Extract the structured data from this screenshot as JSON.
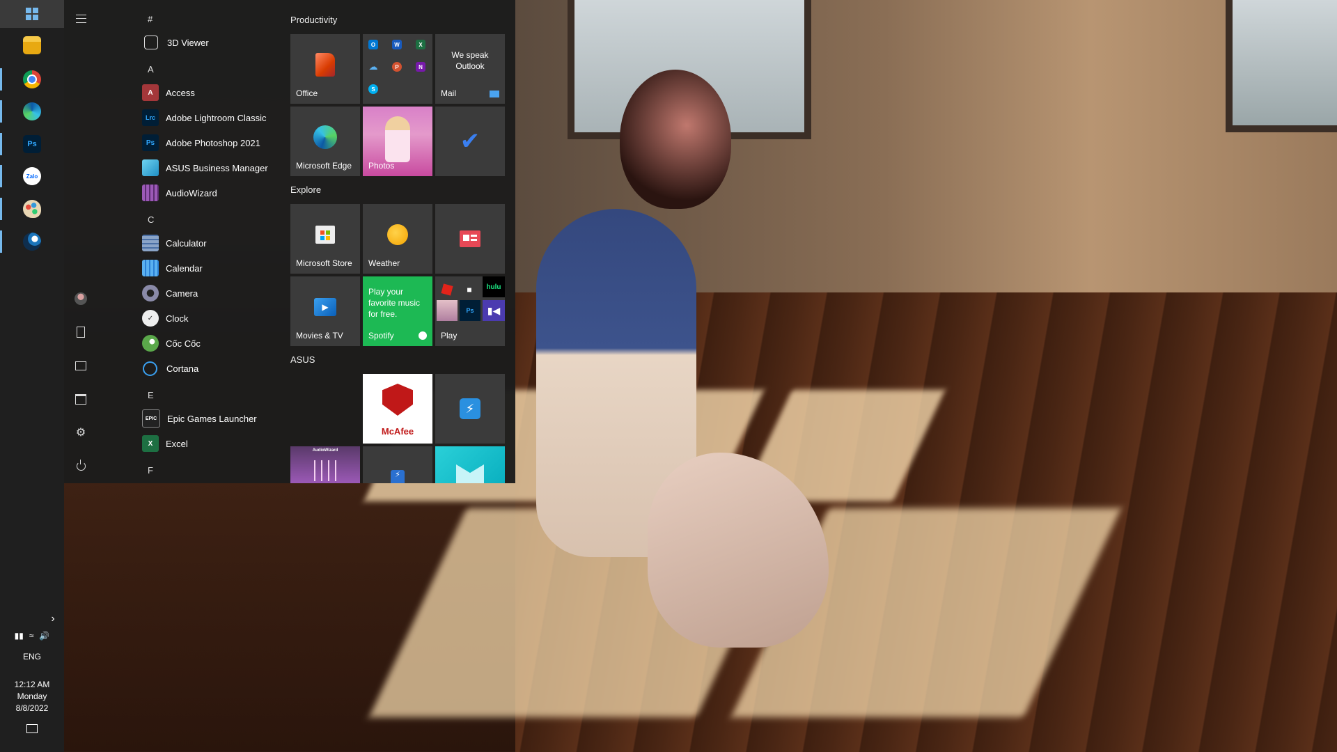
{
  "taskbar": {
    "apps": [
      {
        "name": "File Explorer",
        "icon": "folder-icon"
      },
      {
        "name": "Google Chrome",
        "icon": "chrome-icon"
      },
      {
        "name": "Microsoft Edge",
        "icon": "edge-icon"
      },
      {
        "name": "Adobe Photoshop",
        "icon": "photoshop-icon",
        "text": "Ps"
      },
      {
        "name": "Zalo",
        "icon": "zalo-icon",
        "text": "Zalo"
      },
      {
        "name": "Paint",
        "icon": "paint-icon"
      },
      {
        "name": "Steam",
        "icon": "steam-icon"
      }
    ],
    "tray": {
      "language": "ENG",
      "time": "12:12 AM",
      "day": "Monday",
      "date": "8/8/2022"
    }
  },
  "start_menu": {
    "app_list": [
      {
        "type": "letter",
        "text": "#"
      },
      {
        "type": "app",
        "label": "3D Viewer",
        "icon": "3d-viewer-icon"
      },
      {
        "type": "letter",
        "text": "A"
      },
      {
        "type": "app",
        "label": "Access",
        "icon": "access-icon",
        "glyph": "A",
        "color": "#a4373a"
      },
      {
        "type": "app",
        "label": "Adobe Lightroom Classic",
        "icon": "lightroom-icon",
        "glyph": "Lrc",
        "color": "#001e36"
      },
      {
        "type": "app",
        "label": "Adobe Photoshop 2021",
        "icon": "photoshop-icon",
        "glyph": "Ps",
        "color": "#001e36"
      },
      {
        "type": "app",
        "label": "ASUS Business Manager",
        "icon": "asus-business-manager-icon",
        "glyph": "",
        "color": "#2aa6d8"
      },
      {
        "type": "app",
        "label": "AudioWizard",
        "icon": "audiowizard-icon",
        "glyph": "",
        "color": "#7a3fa0"
      },
      {
        "type": "letter",
        "text": "C"
      },
      {
        "type": "app",
        "label": "Calculator",
        "icon": "calculator-icon",
        "glyph": "",
        "color": "#4a6fa5"
      },
      {
        "type": "app",
        "label": "Calendar",
        "icon": "calendar-icon",
        "glyph": "",
        "color": "#2a7fd4"
      },
      {
        "type": "app",
        "label": "Camera",
        "icon": "camera-icon",
        "glyph": "",
        "color": "#6a6a8a"
      },
      {
        "type": "app",
        "label": "Clock",
        "icon": "clock-icon",
        "glyph": "",
        "color": "#ddd"
      },
      {
        "type": "app",
        "label": "Cốc Cốc",
        "icon": "coccoc-icon",
        "glyph": "",
        "color": "#5aa84a"
      },
      {
        "type": "app",
        "label": "Cortana",
        "icon": "cortana-icon",
        "glyph": "",
        "color": "transparent"
      },
      {
        "type": "letter",
        "text": "E"
      },
      {
        "type": "app",
        "label": "Epic Games Launcher",
        "icon": "epic-games-icon",
        "glyph": "EPIC",
        "color": "#222"
      },
      {
        "type": "app",
        "label": "Excel",
        "icon": "excel-icon",
        "glyph": "X",
        "color": "#1d6f42"
      },
      {
        "type": "letter",
        "text": "F"
      }
    ],
    "groups": [
      {
        "title": "Productivity"
      },
      {
        "title": "Explore"
      },
      {
        "title": "ASUS"
      }
    ],
    "tiles": {
      "office": {
        "label": "Office"
      },
      "mail": {
        "label": "Mail",
        "message": "We speak Outlook"
      },
      "edge": {
        "label": "Microsoft Edge"
      },
      "photos": {
        "label": "Photos"
      },
      "store": {
        "label": "Microsoft Store"
      },
      "weather": {
        "label": "Weather"
      },
      "movies": {
        "label": "Movies & TV"
      },
      "spotify": {
        "label": "Spotify",
        "message": "Play your favorite music for free."
      },
      "play": {
        "label": "Play"
      },
      "mcafee": {
        "label": "McAfee"
      },
      "hulu": {
        "label": "hulu"
      },
      "audiowizard": {
        "label": "AudioWizard"
      }
    },
    "colors": {
      "spotify_green": "#1db954",
      "accent_blue": "#76b9ed",
      "mcafee_red": "#c01818"
    }
  }
}
